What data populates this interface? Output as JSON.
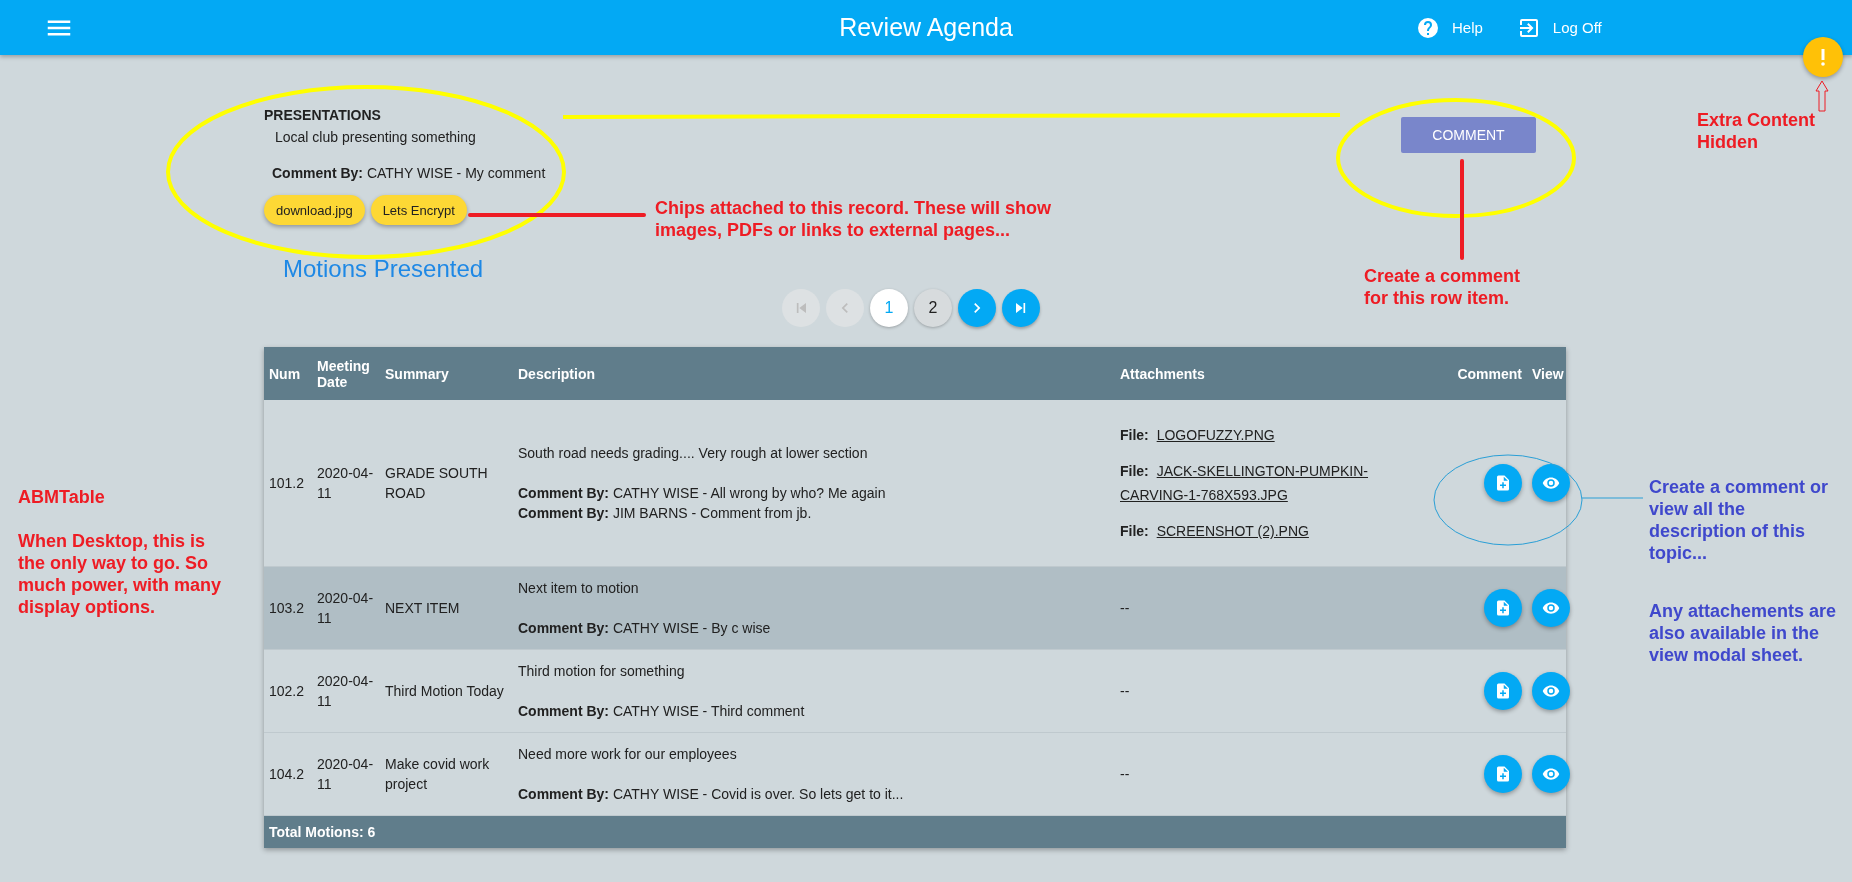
{
  "app_bar": {
    "title": "Review Agenda",
    "help": "Help",
    "log_off": "Log Off"
  },
  "record": {
    "heading": "PRESENTATIONS",
    "text": "Local club presenting something",
    "comment": "**Comment By:** CATHY WISE - My comment",
    "chips": [
      "download.jpg",
      "Lets Encrypt"
    ]
  },
  "comment_button": "COMMENT",
  "section_title": "Motions Presented",
  "pagination": {
    "controls": [
      {
        "kind": "first",
        "disabled": true
      },
      {
        "kind": "prev",
        "disabled": true
      },
      {
        "kind": "page",
        "label": "1",
        "selected": true
      },
      {
        "kind": "page",
        "label": "2",
        "selected": false
      },
      {
        "kind": "next",
        "disabled": false
      },
      {
        "kind": "last",
        "disabled": false
      }
    ]
  },
  "table": {
    "columns": [
      "Num",
      "Meeting Date",
      "Summary",
      "Description",
      "Attachments",
      "Comment",
      "View"
    ],
    "rows": [
      {
        "num": "101.2",
        "date": "2020-04-11",
        "summary": "GRADE SOUTH ROAD",
        "description": "South road needs grading.... Very rough at lower section",
        "comments": [
          "**Comment By:** CATHY WISE - All wrong by who? Me again",
          "**Comment By:** JIM BARNS - Comment from jb."
        ],
        "attachments": [
          {
            "label": "File:",
            "name": "LOGOFUZZY.PNG"
          },
          {
            "label": "File:",
            "name": "JACK-SKELLINGTON-PUMPKIN-CARVING-1-768X593.JPG"
          },
          {
            "label": "File:",
            "name": "SCREENSHOT (2).PNG"
          }
        ],
        "highlighted": false
      },
      {
        "num": "103.2",
        "date": "2020-04-11",
        "summary": "NEXT ITEM",
        "description": "Next item to motion",
        "comments": [
          "**Comment By:** CATHY WISE - By c wise"
        ],
        "no_attachments": "--",
        "highlighted": true
      },
      {
        "num": "102.2",
        "date": "2020-04-11",
        "summary": "Third Motion Today",
        "description": "Third motion for something",
        "comments": [
          "**Comment By:** CATHY WISE - Third comment"
        ],
        "no_attachments": "--",
        "highlighted": false
      },
      {
        "num": "104.2",
        "date": "2020-04-11",
        "summary": "Make covid work project",
        "description": "Need more work for our employees",
        "comments": [
          "**Comment By:** CATHY WISE - Covid is over. So lets get to it..."
        ],
        "no_attachments": "--",
        "highlighted": false
      }
    ],
    "footer": "Total Motions: 6"
  },
  "annotations": [
    {
      "text": "Chips attached to this record. These will show images, PDFs or links to external pages...",
      "color": "#ee1c24"
    },
    {
      "text": "Create a comment for this row item.",
      "color": "#ee1c24"
    },
    {
      "text": "Extra Content Hidden",
      "color": "#ee1c24"
    },
    {
      "text": "ABMTable",
      "color": "#ee1c24"
    },
    {
      "text": "When Desktop, this is the only way to go. So much power, with many display options.",
      "color": "#ee1c24"
    },
    {
      "text": "Create a comment or view all the description of this topic...",
      "color": "#3f48cc"
    },
    {
      "text": "Any attachements are also available in the view modal sheet.",
      "color": "#3f48cc"
    }
  ]
}
